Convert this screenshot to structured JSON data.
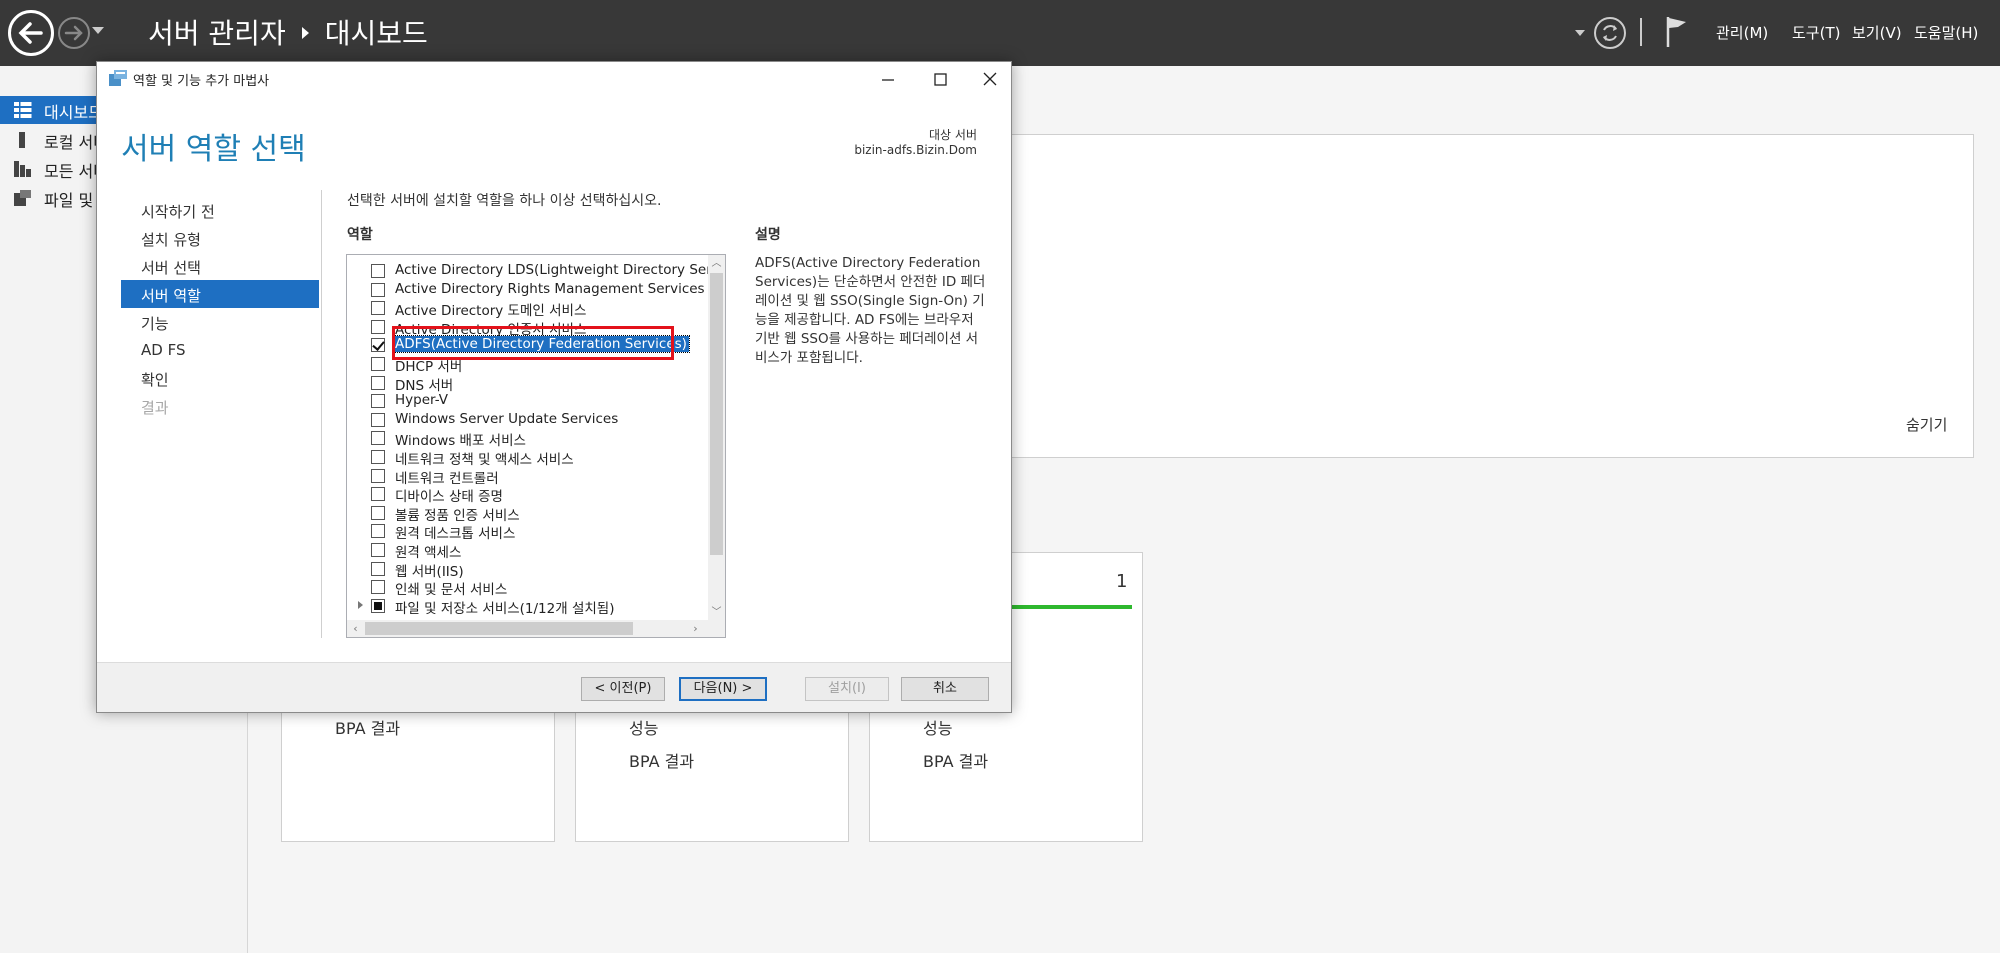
{
  "topbar": {
    "breadcrumb_root": "서버 관리자",
    "breadcrumb_current": "대시보드",
    "menus": [
      "관리(M)",
      "도구(T)",
      "보기(V)",
      "도움말(H)"
    ]
  },
  "sidebar": {
    "items": [
      {
        "label": "대시보드",
        "icon": "dashboard-icon",
        "active": true
      },
      {
        "label": "로컬 서버",
        "icon": "server-icon",
        "active": false
      },
      {
        "label": "모든 서버",
        "icon": "servers-icon",
        "active": false
      },
      {
        "label": "파일 및 저장소 서비스",
        "icon": "file-storage-icon",
        "active": false
      }
    ]
  },
  "background": {
    "hide_link": "숨기기",
    "tile_count": "1",
    "tile1_lines": [
      "BPA 결과"
    ],
    "tile2_lines": [
      "성능",
      "BPA 결과"
    ],
    "tile3_lines": [
      "성능",
      "BPA 결과"
    ]
  },
  "dialog": {
    "title": "역할 및 기능 추가 마법사",
    "heading": "서버 역할 선택",
    "target_label": "대상 서버",
    "target_value": "bizin-adfs.Bizin.Dom",
    "steps": [
      {
        "label": "시작하기 전",
        "state": "normal"
      },
      {
        "label": "설치 유형",
        "state": "normal"
      },
      {
        "label": "서버 선택",
        "state": "normal"
      },
      {
        "label": "서버 역할",
        "state": "active"
      },
      {
        "label": "기능",
        "state": "normal"
      },
      {
        "label": "AD FS",
        "state": "normal"
      },
      {
        "label": "확인",
        "state": "normal"
      },
      {
        "label": "결과",
        "state": "disabled"
      }
    ],
    "instruction": "선택한 서버에 설치할 역할을 하나 이상 선택하십시오.",
    "roles_label": "역할",
    "description_label": "설명",
    "description": "ADFS(Active Directory Federation Services)는 단순하면서 안전한 ID 페더레이션 및 웹 SSO(Single Sign-On) 기능을 제공합니다. AD FS에는 브라우저 기반 웹 SSO를 사용하는 페더레이션 서비스가 포함됩니다.",
    "roles": [
      {
        "label": "Active Directory LDS(Lightweight Directory Services)",
        "checked": false
      },
      {
        "label": "Active Directory Rights Management Services",
        "checked": false
      },
      {
        "label": "Active Directory 도메인 서비스",
        "checked": false
      },
      {
        "label": "Active Directory 인증서 서비스",
        "checked": false
      },
      {
        "label": "ADFS(Active Directory Federation Services)",
        "checked": true,
        "selected": true
      },
      {
        "label": "DHCP 서버",
        "checked": false
      },
      {
        "label": "DNS 서버",
        "checked": false
      },
      {
        "label": "Hyper-V",
        "checked": false
      },
      {
        "label": "Windows Server Update Services",
        "checked": false
      },
      {
        "label": "Windows 배포 서비스",
        "checked": false
      },
      {
        "label": "네트워크 정책 및 액세스 서비스",
        "checked": false
      },
      {
        "label": "네트워크 컨트롤러",
        "checked": false
      },
      {
        "label": "디바이스 상태 증명",
        "checked": false
      },
      {
        "label": "볼륨 정품 인증 서비스",
        "checked": false
      },
      {
        "label": "원격 데스크톱 서비스",
        "checked": false
      },
      {
        "label": "원격 액세스",
        "checked": false
      },
      {
        "label": "웹 서버(IIS)",
        "checked": false
      },
      {
        "label": "인쇄 및 문서 서비스",
        "checked": false
      },
      {
        "label": "파일 및 저장소 서비스(1/12개 설치됨)",
        "checked": "partial",
        "expandable": true
      }
    ],
    "buttons": {
      "previous": "< 이전(P)",
      "next": "다음(N) >",
      "install": "설치(I)",
      "cancel": "취소"
    }
  },
  "colors": {
    "accent": "#1e6fc2",
    "heading": "#1f7fb5",
    "highlight": "#e3121b",
    "topbar": "#383838"
  }
}
